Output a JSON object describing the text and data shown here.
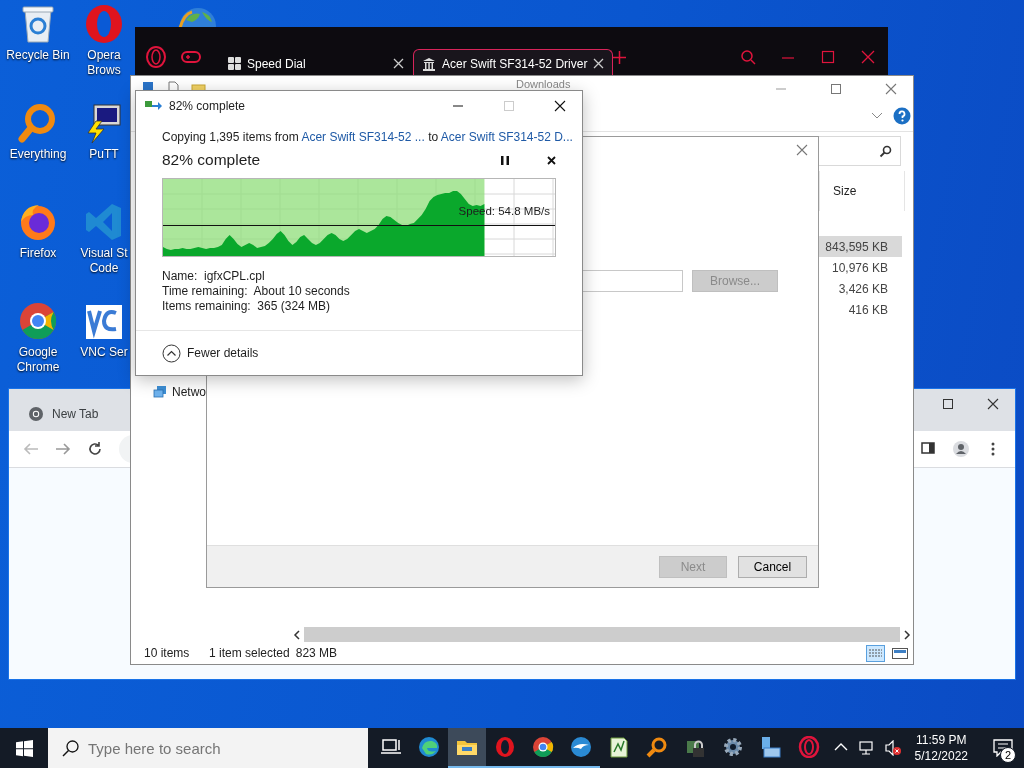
{
  "desktop_icons": [
    {
      "kind": "recycle",
      "label": "Recycle Bin"
    },
    {
      "kind": "opera",
      "label": "Opera Brows"
    },
    {
      "kind": "everything",
      "label": "Everything"
    },
    {
      "kind": "putty",
      "label": "PuTT"
    },
    {
      "kind": "firefox",
      "label": "Firefox"
    },
    {
      "kind": "vscode",
      "label": "Visual St Code"
    },
    {
      "kind": "chrome",
      "label": "Google Chrome"
    },
    {
      "kind": "vnc",
      "label": "VNC Ser"
    }
  ],
  "opera": {
    "tabs": [
      {
        "label": "Speed Dial",
        "selected": false
      },
      {
        "label": "Acer Swift SF314-52 Driver",
        "selected": true
      }
    ]
  },
  "explorer": {
    "title": "Downloads",
    "size_header": "Size",
    "sizes": [
      {
        "value": "843,595 KB",
        "selected": true
      },
      {
        "value": "10,976 KB",
        "selected": false
      },
      {
        "value": "3,426 KB",
        "selected": false
      },
      {
        "value": "416 KB",
        "selected": false
      }
    ],
    "nav_item": "Netwo",
    "status": {
      "count": "10 items",
      "selection": "1 item selected",
      "size": "823 MB"
    },
    "wizard": {
      "buttons": [
        {
          "kind": "browse",
          "label": "Browse...",
          "disabled": true
        },
        {
          "kind": "next",
          "label": "Next",
          "disabled": true
        },
        {
          "kind": "cancel",
          "label": "Cancel",
          "disabled": false
        }
      ]
    }
  },
  "chrome": {
    "tab": "New Tab"
  },
  "copy_dialog": {
    "title": "82% complete",
    "summary": {
      "prefix": "Copying 1,395 items from",
      "source": "Acer Swift SF314-52 ...",
      "middle": "to",
      "destination": "Acer Swift SF314-52 D..."
    },
    "heading": "82% complete",
    "level": 0.82,
    "speed": "Speed: 54.8 MB/s",
    "details": [
      {
        "label": "Name:",
        "value": "igfxCPL.cpl"
      },
      {
        "label": "Time remaining:",
        "value": "About 10 seconds"
      },
      {
        "label": "Items remaining:",
        "value": "365 (324 MB)"
      }
    ],
    "toggle": "Fewer details"
  },
  "taskbar": {
    "search_placeholder": "Type here to search",
    "apps": [
      {
        "kind": "taskview",
        "running": false,
        "selected": false
      },
      {
        "kind": "edge",
        "running": false,
        "selected": false
      },
      {
        "kind": "folder",
        "running": true,
        "selected": true
      },
      {
        "kind": "opera",
        "running": true,
        "selected": false
      },
      {
        "kind": "chrome",
        "running": true,
        "selected": false
      },
      {
        "kind": "bird",
        "running": true,
        "selected": false
      },
      {
        "kind": "notepad",
        "running": false,
        "selected": false
      },
      {
        "kind": "everything",
        "running": false,
        "selected": false
      },
      {
        "kind": "lock",
        "running": false,
        "selected": false
      },
      {
        "kind": "gear",
        "running": false,
        "selected": false
      },
      {
        "kind": "computer",
        "running": false,
        "selected": false
      },
      {
        "kind": "operagx",
        "running": false,
        "selected": false
      }
    ],
    "time": "11:59 PM",
    "date": "5/12/2022",
    "notifications": "2"
  }
}
